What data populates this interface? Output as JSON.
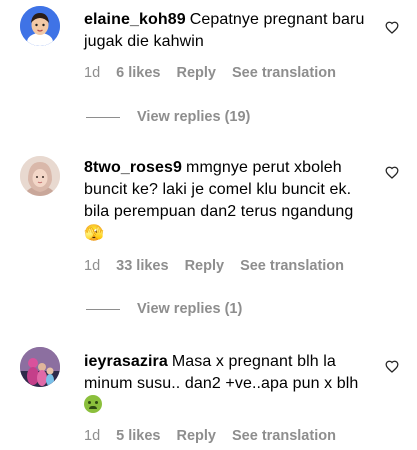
{
  "comments": [
    {
      "username": "elaine_koh89",
      "text": "Cepatnye pregnant baru jugak die kahwin",
      "time": "1d",
      "likes": "6 likes",
      "reply": "Reply",
      "translate": "See translation",
      "view_replies": "View replies (19)"
    },
    {
      "username": "8two_roses9",
      "text": "mmgnye perut xboleh buncit ke? laki je comel klu buncit ek. bila perempuan dan2 terus ngandung 🫣",
      "time": "1d",
      "likes": "33 likes",
      "reply": "Reply",
      "translate": "See translation",
      "view_replies": "View replies (1)"
    },
    {
      "username": "ieyrasazira",
      "text": "Masa x pregnant blh la minum susu.. dan2 +ve..apa pun x blh",
      "emoji": "nauseated-face",
      "time": "1d",
      "likes": "5 likes",
      "reply": "Reply",
      "translate": "See translation"
    }
  ]
}
